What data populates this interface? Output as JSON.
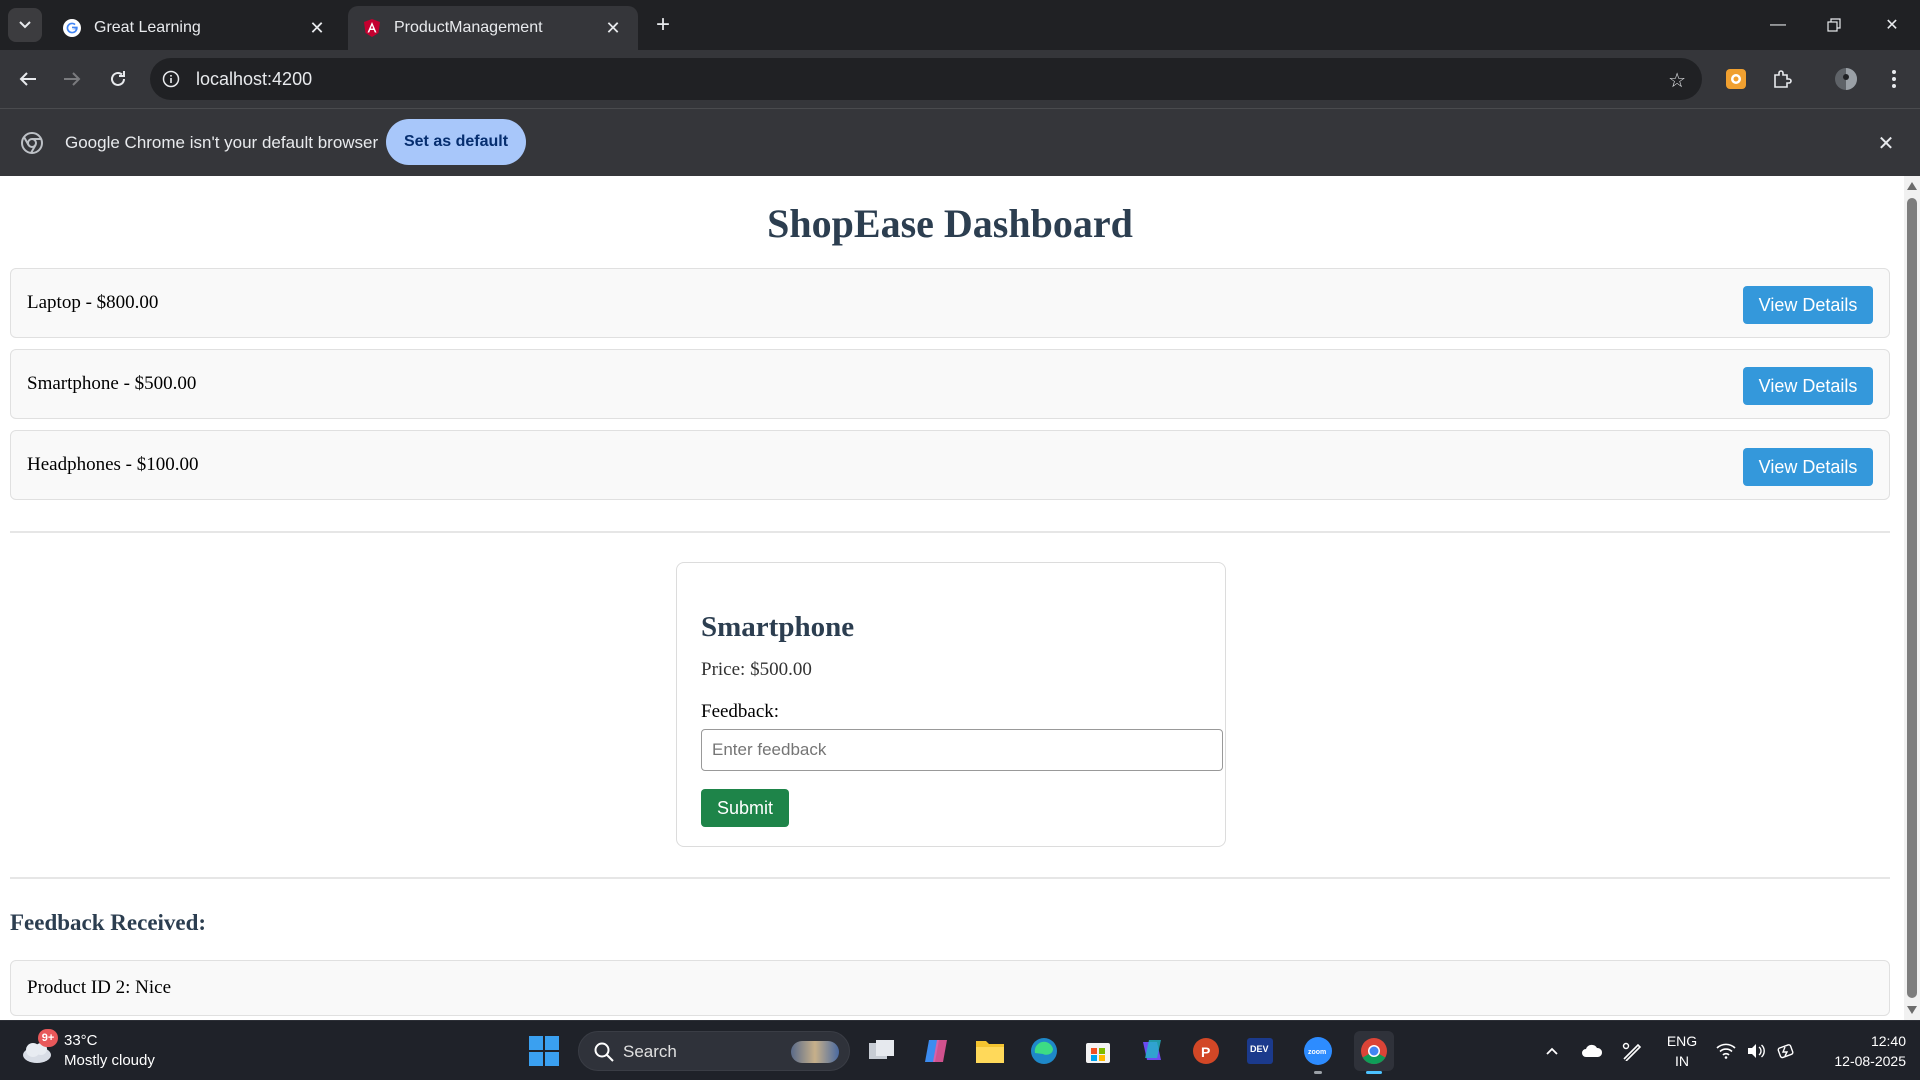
{
  "browser": {
    "tabs": [
      {
        "title": "Great Learning",
        "active": false
      },
      {
        "title": "ProductManagement",
        "active": true
      }
    ],
    "address_bar": {
      "url": "localhost:4200"
    },
    "infobar": {
      "message": "Google Chrome isn't your default browser",
      "button_label": "Set as default"
    }
  },
  "page": {
    "title": "ShopEase Dashboard",
    "products": [
      {
        "text": "Laptop - $800.00",
        "button_label": "View Details"
      },
      {
        "text": "Smartphone - $500.00",
        "button_label": "View Details"
      },
      {
        "text": "Headphones - $100.00",
        "button_label": "View Details"
      }
    ],
    "details": {
      "name": "Smartphone",
      "price_text": "Price: $500.00",
      "feedback_label": "Feedback:",
      "feedback_value": "",
      "feedback_placeholder": "Enter feedback",
      "submit_label": "Submit"
    },
    "feedback_section": {
      "heading": "Feedback Received:",
      "items": [
        "Product ID 2: Nice"
      ]
    }
  },
  "taskbar": {
    "weather": {
      "temp": "33°C",
      "desc": "Mostly cloudy",
      "badge": "9+"
    },
    "search_label": "Search",
    "language": {
      "line1": "ENG",
      "line2": "IN"
    },
    "clock": {
      "time": "12:40",
      "date": "12-08-2025"
    }
  },
  "colors": {
    "heading": "#2c3e50",
    "view_button": "#3498db",
    "submit_button": "#1e8449",
    "set_default_button": "#a8c7fa"
  }
}
